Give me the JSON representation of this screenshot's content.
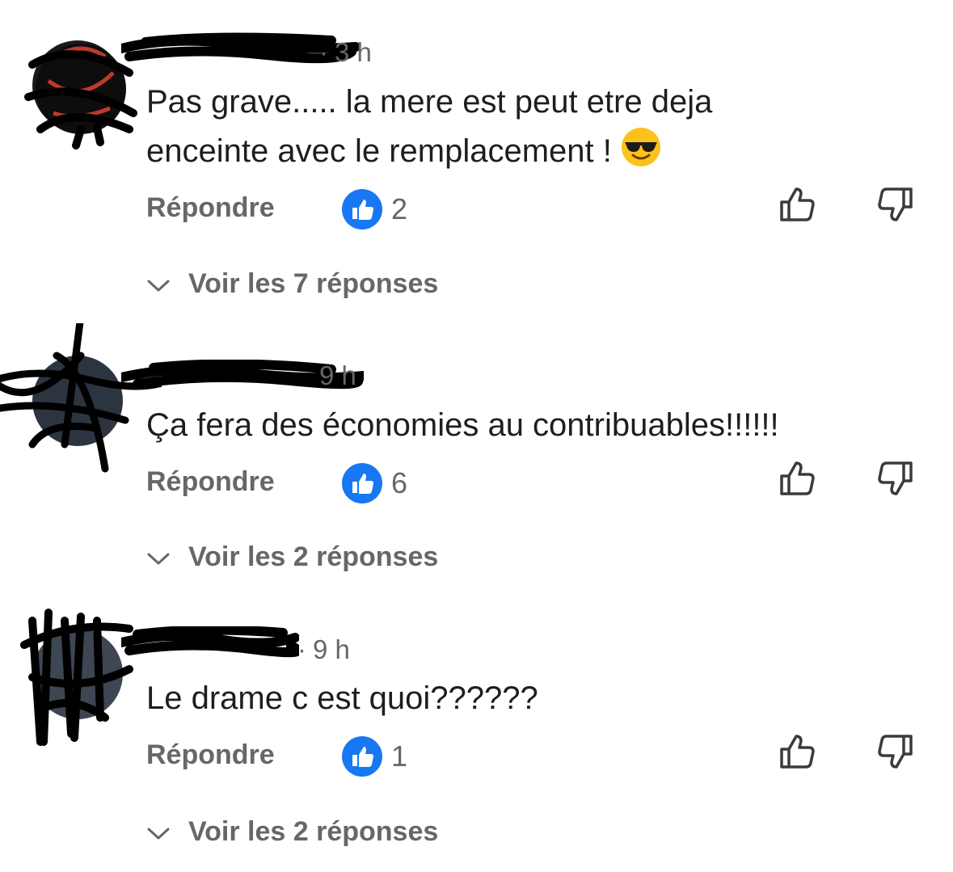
{
  "comments": [
    {
      "time": "3 h",
      "text_line1": "Pas grave..... la mere est peut etre deja",
      "text_line2": "enceinte avec le remplacement !",
      "emoji": "smiling-face-with-sunglasses",
      "reply_label": "Répondre",
      "likes": "2",
      "view_replies_label": "Voir les 7 réponses"
    },
    {
      "time": "9 h",
      "text_line1": "Ça fera des économies au contribuables!!!!!!",
      "reply_label": "Répondre",
      "likes": "6",
      "view_replies_label": "Voir les 2 réponses"
    },
    {
      "time": "9 h",
      "text_line1": "Le drame c est quoi??????",
      "reply_label": "Répondre",
      "likes": "1",
      "view_replies_label": "Voir les 2 réponses"
    }
  ],
  "colors": {
    "like_blue": "#1877f2",
    "secondary_text": "#65676b",
    "primary_text": "#1c1e21",
    "redaction": "#000000"
  },
  "icons": {
    "like_badge": "thumbs-up-badge-icon",
    "upvote": "thumb-up-outline-icon",
    "downvote": "thumb-down-outline-icon",
    "expand": "chevron-down-icon"
  }
}
